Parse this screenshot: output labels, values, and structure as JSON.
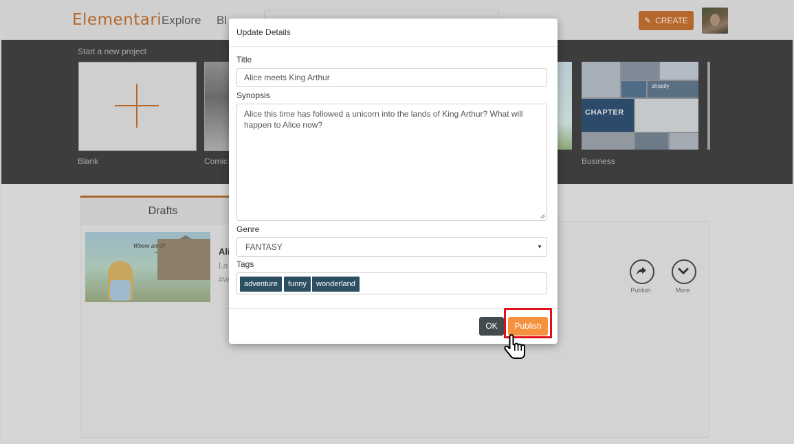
{
  "header": {
    "logo": "Elementari",
    "nav": {
      "explore": "Explore",
      "blog": "Bl"
    },
    "create_label": "CREATE",
    "create_icon": "pencil-icon"
  },
  "projects": {
    "heading": "Start a new project",
    "tiles": [
      {
        "label": "Blank"
      },
      {
        "label": "Comic"
      },
      {
        "label": "Business",
        "image_text": "CHAPTER",
        "image_logo": "shopify"
      }
    ]
  },
  "drafts": {
    "tab_label": "Drafts",
    "item": {
      "thumb_caption": "Where am I?",
      "title_fragment": "Ali",
      "subtitle_fragment": "La",
      "tags_fragment": "#w"
    },
    "actions": {
      "publish": "Publish",
      "more": "More"
    }
  },
  "modal": {
    "title": "Update Details",
    "title_label": "Title",
    "title_value": "Alice meets King Arthur",
    "synopsis_label": "Synopsis",
    "synopsis_value": "Alice this time has followed a unicorn into the lands of King Arthur? What will happen to Alice now?",
    "genre_label": "Genre",
    "genre_value": "FANTASY",
    "tags_label": "Tags",
    "tags": [
      "adventure",
      "funny",
      "wonderland"
    ],
    "ok_label": "OK",
    "publish_label": "Publish"
  },
  "colors": {
    "brand": "#b5682e",
    "publish": "#f5913f",
    "tag": "#2d4f63",
    "highlight": "#e01019"
  }
}
